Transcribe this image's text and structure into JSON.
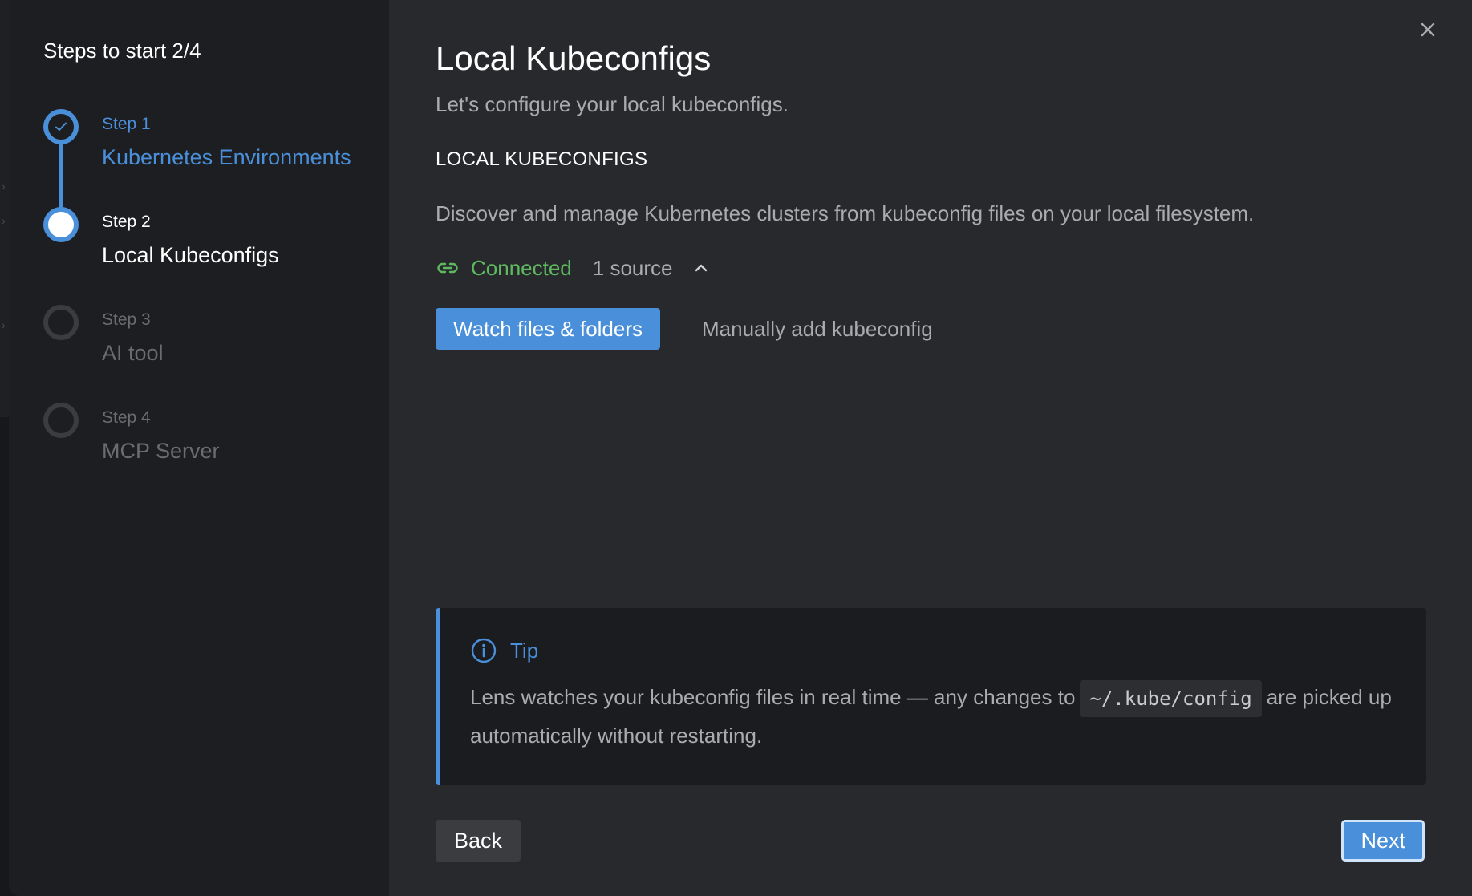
{
  "sidebar": {
    "title": "Steps to start 2/4",
    "steps": [
      {
        "number": "Step 1",
        "label": "Kubernetes Environments",
        "state": "done"
      },
      {
        "number": "Step 2",
        "label": "Local Kubeconfigs",
        "state": "current"
      },
      {
        "number": "Step 3",
        "label": "AI tool",
        "state": "pending"
      },
      {
        "number": "Step 4",
        "label": "MCP Server",
        "state": "pending"
      }
    ]
  },
  "main": {
    "title": "Local Kubeconfigs",
    "subtitle": "Let's configure your local kubeconfigs.",
    "section_title": "LOCAL KUBECONFIGS",
    "section_desc": "Discover and manage Kubernetes clusters from kubeconfig files on your local filesystem.",
    "status": {
      "label": "Connected",
      "count": "1 source",
      "icon": "link-icon",
      "expanded": true
    },
    "actions": {
      "watch_label": "Watch files & folders",
      "manual_label": "Manually add kubeconfig"
    },
    "tip": {
      "title": "Tip",
      "text_before": "Lens watches your kubeconfig files in real time — any changes to",
      "code": "~/.kube/config",
      "text_after": "are picked up automatically without restarting."
    },
    "footer": {
      "back_label": "Back",
      "next_label": "Next"
    }
  },
  "colors": {
    "accent": "#4a8fd9",
    "success": "#5fb85f",
    "sidebar_bg": "#1d1e21",
    "main_bg": "#27292d",
    "tip_bg": "#1b1c1f"
  }
}
